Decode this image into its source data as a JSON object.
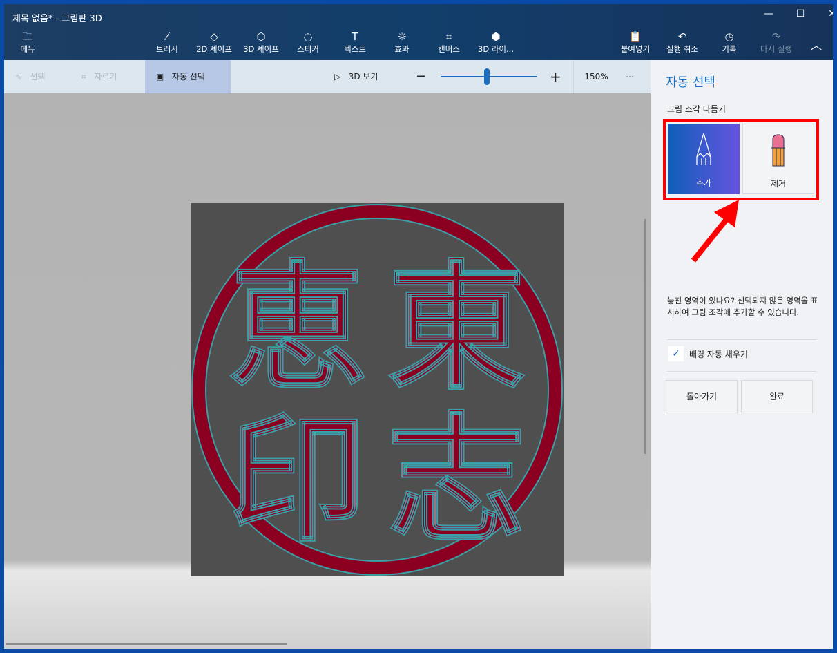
{
  "window": {
    "title": "제목 없음* - 그림판 3D"
  },
  "toolbar": {
    "items": [
      {
        "label": "메뉴",
        "icon": "folder-icon"
      },
      {
        "label": "브러시",
        "icon": "brush-icon"
      },
      {
        "label": "2D 셰이프",
        "icon": "2d-shape-icon"
      },
      {
        "label": "3D 셰이프",
        "icon": "3d-shape-icon"
      },
      {
        "label": "스티커",
        "icon": "sticker-icon"
      },
      {
        "label": "텍스트",
        "icon": "text-icon"
      },
      {
        "label": "효과",
        "icon": "effects-icon"
      },
      {
        "label": "캔버스",
        "icon": "canvas-icon"
      },
      {
        "label": "3D 라이...",
        "icon": "3d-library-icon"
      },
      {
        "label": "붙여넣기",
        "icon": "paste-icon"
      },
      {
        "label": "실행 취소",
        "icon": "undo-icon"
      },
      {
        "label": "기록",
        "icon": "history-icon"
      },
      {
        "label": "다시 실행",
        "icon": "redo-icon"
      }
    ]
  },
  "subtoolbar": {
    "select": "선택",
    "crop": "자르기",
    "magic_select": "자동 선택",
    "view3d": "3D 보기",
    "zoom": "150%",
    "zoom_fraction": 0.48
  },
  "canvas": {
    "stamp_text": "恵印東志"
  },
  "panel": {
    "title": "자동 선택",
    "section": "그림 조각 다듬기",
    "add": "추가",
    "remove": "제거",
    "hint": "놓친 영역이 있나요? 선택되지 않은 영역을 표시하여 그림 조각에 추가할 수 있습니다.",
    "autofill": "배경 자동 채우기",
    "autofill_checked": true,
    "back": "돌아가기",
    "done": "완료"
  },
  "colors": {
    "accent": "#1c6ec0",
    "annotation": "#ff0000",
    "stamp": "#8b0020"
  }
}
